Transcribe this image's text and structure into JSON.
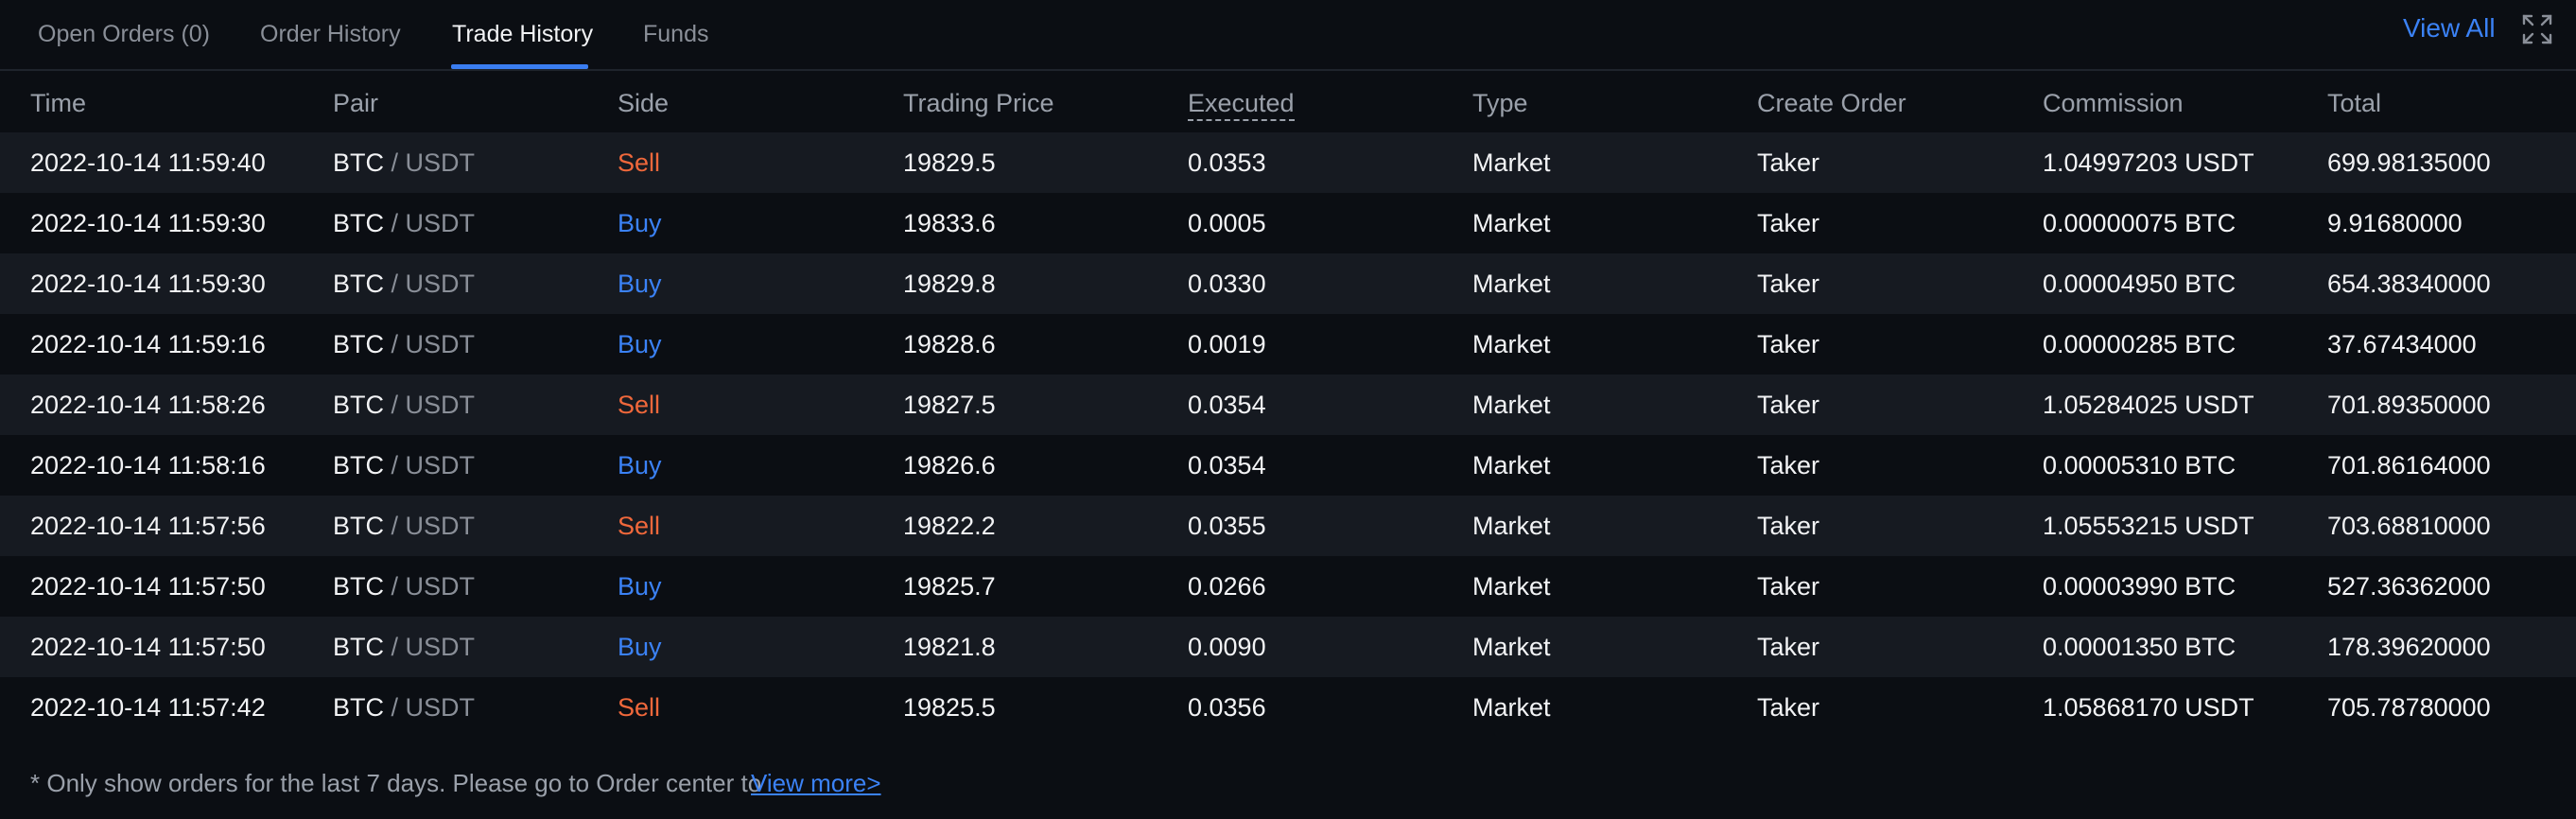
{
  "tabs": [
    {
      "label": "Open Orders (0)"
    },
    {
      "label": "Order History"
    },
    {
      "label": "Trade History"
    },
    {
      "label": "Funds"
    }
  ],
  "active_tab": "Trade History",
  "view_all_label": "View All",
  "icons": {
    "expand": "expand-icon"
  },
  "colors": {
    "sell": "#f0683b",
    "buy": "#3b82f6",
    "accent": "#3a7df0"
  },
  "columns": [
    "Time",
    "Pair",
    "Side",
    "Trading Price",
    "Executed",
    "Type",
    "Create Order",
    "Commission",
    "Total"
  ],
  "rows": [
    {
      "time": "2022-10-14 11:59:40",
      "base": "BTC",
      "sep": " / ",
      "quote": "USDT",
      "side": "Sell",
      "price": "19829.5",
      "executed": "0.0353",
      "type": "Market",
      "create_order": "Taker",
      "commission": "1.04997203 USDT",
      "total": "699.98135000"
    },
    {
      "time": "2022-10-14 11:59:30",
      "base": "BTC",
      "sep": " / ",
      "quote": "USDT",
      "side": "Buy",
      "price": "19833.6",
      "executed": "0.0005",
      "type": "Market",
      "create_order": "Taker",
      "commission": "0.00000075 BTC",
      "total": "9.91680000"
    },
    {
      "time": "2022-10-14 11:59:30",
      "base": "BTC",
      "sep": " / ",
      "quote": "USDT",
      "side": "Buy",
      "price": "19829.8",
      "executed": "0.0330",
      "type": "Market",
      "create_order": "Taker",
      "commission": "0.00004950 BTC",
      "total": "654.38340000"
    },
    {
      "time": "2022-10-14 11:59:16",
      "base": "BTC",
      "sep": " / ",
      "quote": "USDT",
      "side": "Buy",
      "price": "19828.6",
      "executed": "0.0019",
      "type": "Market",
      "create_order": "Taker",
      "commission": "0.00000285 BTC",
      "total": "37.67434000"
    },
    {
      "time": "2022-10-14 11:58:26",
      "base": "BTC",
      "sep": " / ",
      "quote": "USDT",
      "side": "Sell",
      "price": "19827.5",
      "executed": "0.0354",
      "type": "Market",
      "create_order": "Taker",
      "commission": "1.05284025 USDT",
      "total": "701.89350000"
    },
    {
      "time": "2022-10-14 11:58:16",
      "base": "BTC",
      "sep": " / ",
      "quote": "USDT",
      "side": "Buy",
      "price": "19826.6",
      "executed": "0.0354",
      "type": "Market",
      "create_order": "Taker",
      "commission": "0.00005310 BTC",
      "total": "701.86164000"
    },
    {
      "time": "2022-10-14 11:57:56",
      "base": "BTC",
      "sep": " / ",
      "quote": "USDT",
      "side": "Sell",
      "price": "19822.2",
      "executed": "0.0355",
      "type": "Market",
      "create_order": "Taker",
      "commission": "1.05553215 USDT",
      "total": "703.68810000"
    },
    {
      "time": "2022-10-14 11:57:50",
      "base": "BTC",
      "sep": " / ",
      "quote": "USDT",
      "side": "Buy",
      "price": "19825.7",
      "executed": "0.0266",
      "type": "Market",
      "create_order": "Taker",
      "commission": "0.00003990 BTC",
      "total": "527.36362000"
    },
    {
      "time": "2022-10-14 11:57:50",
      "base": "BTC",
      "sep": " / ",
      "quote": "USDT",
      "side": "Buy",
      "price": "19821.8",
      "executed": "0.0090",
      "type": "Market",
      "create_order": "Taker",
      "commission": "0.00001350 BTC",
      "total": "178.39620000"
    },
    {
      "time": "2022-10-14 11:57:42",
      "base": "BTC",
      "sep": " / ",
      "quote": "USDT",
      "side": "Sell",
      "price": "19825.5",
      "executed": "0.0356",
      "type": "Market",
      "create_order": "Taker",
      "commission": "1.05868170 USDT",
      "total": "705.78780000"
    }
  ],
  "footnote": "* Only show orders for the last 7 days. Please go to Order center to",
  "footnote_link": "View more>"
}
